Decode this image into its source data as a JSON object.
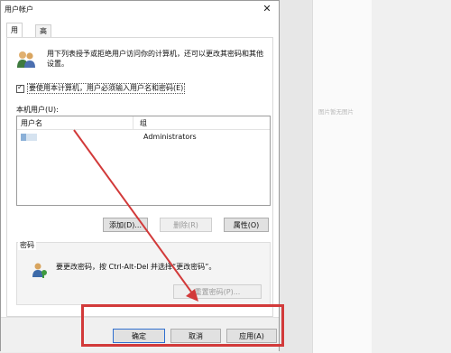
{
  "dialog": {
    "title": "用户帐户",
    "close_glyph": "✕"
  },
  "tabs": [
    {
      "label": "用户",
      "active": true
    },
    {
      "label": "高级",
      "active": false
    }
  ],
  "intro_text": "用下列表授予或拒绝用户访问你的计算机，还可以更改其密码和其他设置。",
  "require_login_checkbox": {
    "label": "要使用本计算机，用户必须输入用户名和密码(E)",
    "checked": true
  },
  "users_list": {
    "label": "本机用户(U):",
    "columns": [
      "用户名",
      "组"
    ],
    "rows": [
      {
        "name": "",
        "group": "Administrators"
      }
    ]
  },
  "list_buttons": {
    "add": "添加(D)...",
    "remove": "删除(R)",
    "properties": "属性(O)"
  },
  "password_group": {
    "title": "密码",
    "text": "要更改密码，按 Ctrl-Alt-Del 并选择“更改密码”。",
    "reset_button": "重置密码(P)..."
  },
  "footer_buttons": {
    "ok": "确定",
    "cancel": "取消",
    "apply": "应用(A)"
  },
  "right_panel": {
    "placeholder": "图片暂无图片"
  },
  "colors": {
    "annotation_red": "#d23a3a",
    "default_button_border": "#2f6fcf"
  },
  "icons": {
    "users": "users-icon",
    "password": "key-user-icon",
    "user_row": "user-icon",
    "close": "close-icon"
  }
}
